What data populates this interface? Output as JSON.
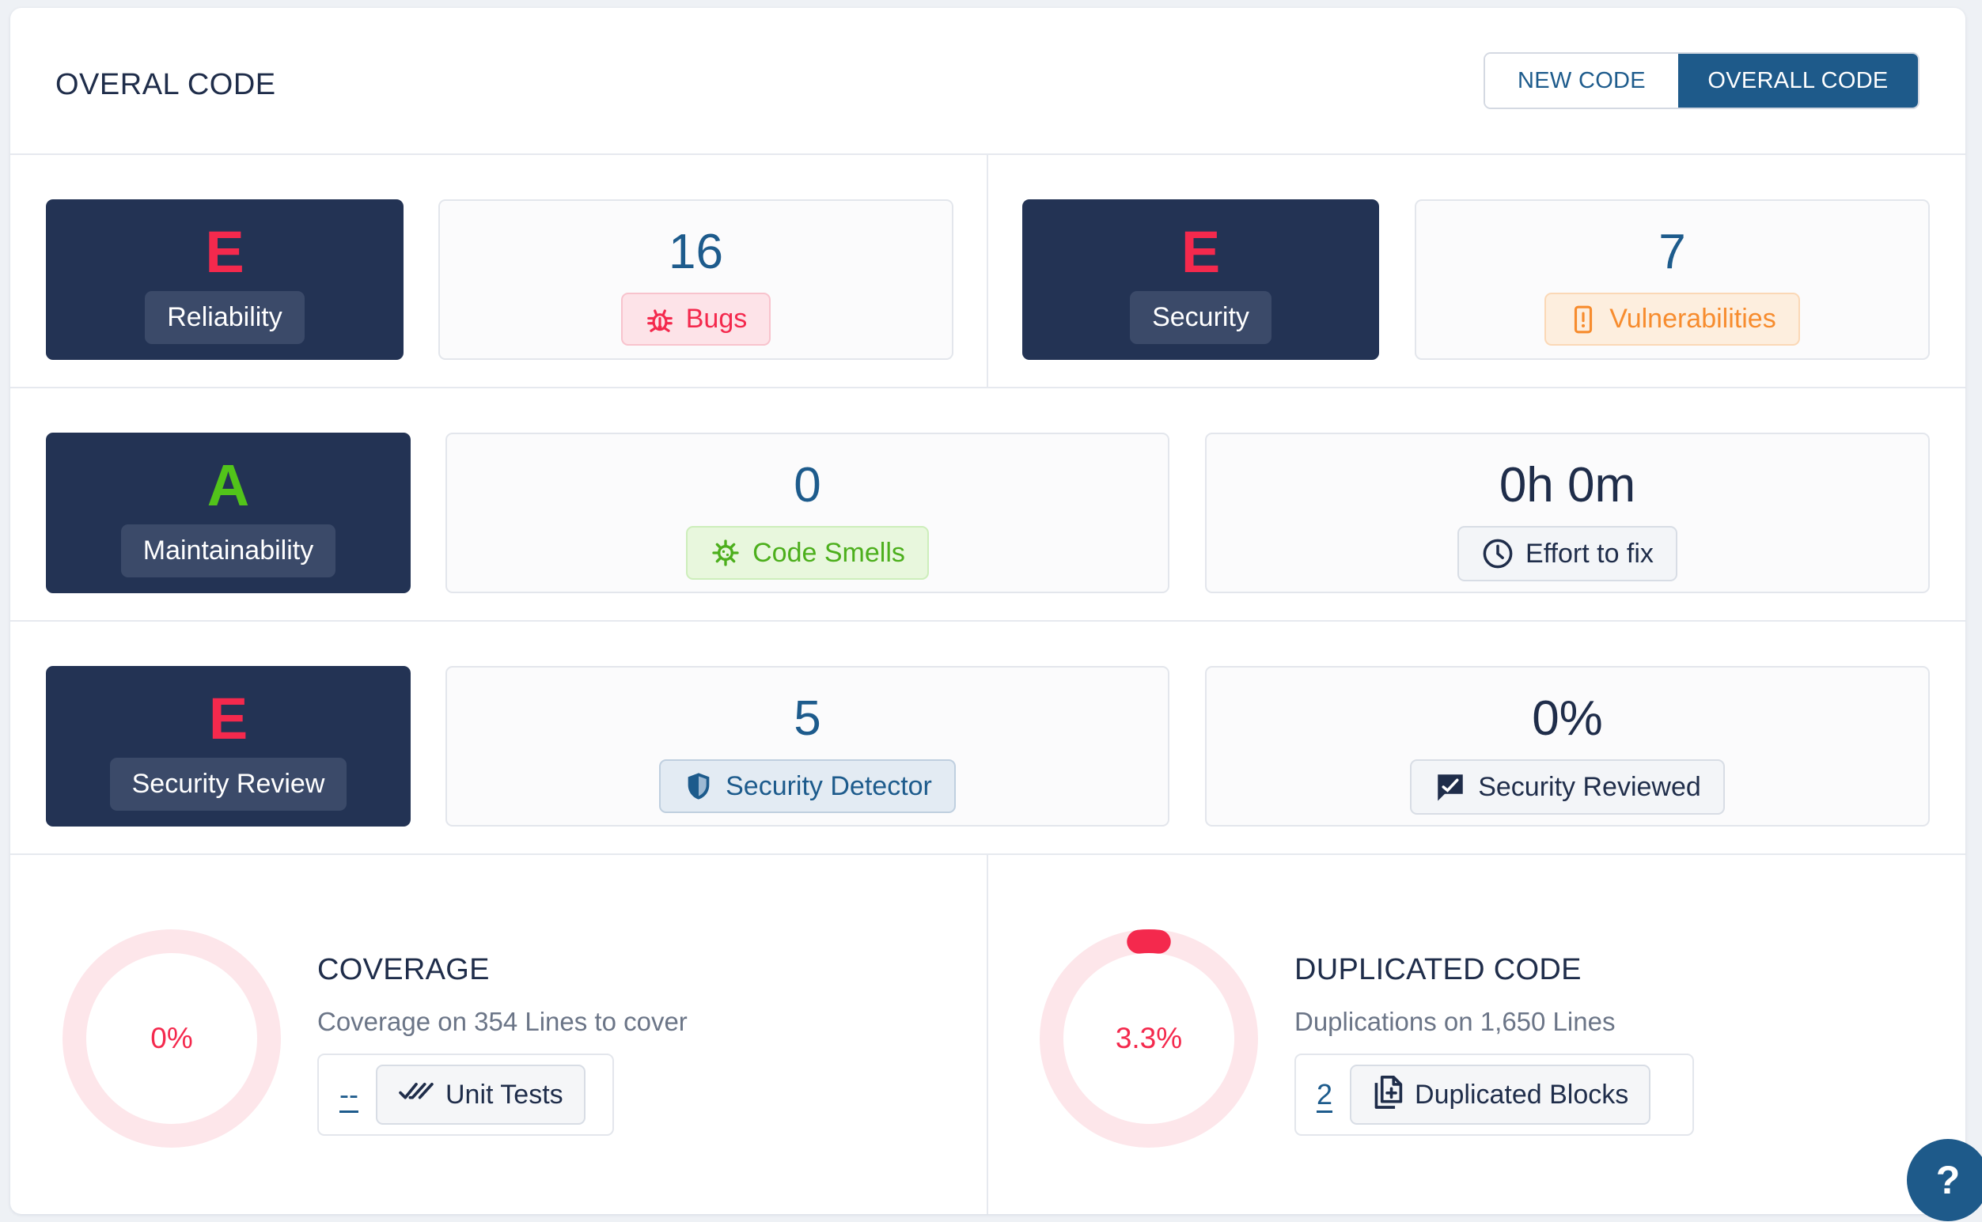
{
  "header": {
    "title": "OVERAL CODE",
    "toggle": {
      "new_label": "NEW CODE",
      "overall_label": "OVERALL CODE",
      "selected": "OVERALL CODE"
    }
  },
  "reliability": {
    "grade": "E",
    "label": "Reliability",
    "count": "16",
    "tag": "Bugs",
    "icon": "bug-icon"
  },
  "security": {
    "grade": "E",
    "label": "Security",
    "count": "7",
    "tag": "Vulnerabilities",
    "icon": "phone-alert-icon"
  },
  "maintainability": {
    "grade": "A",
    "label": "Maintainability",
    "count": "0",
    "tag": "Code Smells",
    "icon": "virus-icon",
    "effort_value": "0h 0m",
    "effort_tag": "Effort to fix",
    "effort_icon": "clock-icon"
  },
  "security_review": {
    "grade": "E",
    "label": "Security Review",
    "count": "5",
    "tag": "Security Detector",
    "icon": "shield-icon",
    "reviewed_value": "0%",
    "reviewed_tag": "Security Reviewed",
    "reviewed_icon": "pen-check-icon"
  },
  "coverage": {
    "title": "COVERAGE",
    "subtitle": "Coverage on 354 Lines to cover",
    "percent_label": "0%",
    "percent": 0,
    "link": "--",
    "button": "Unit Tests",
    "button_icon": "double-check-icon"
  },
  "duplication": {
    "title": "DUPLICATED CODE",
    "subtitle": "Duplications on 1,650 Lines",
    "percent_label": "3.3%",
    "percent": 3.3,
    "link": "2",
    "button": "Duplicated Blocks",
    "button_icon": "copy-doc-icon"
  },
  "help": {
    "label": "?"
  },
  "colors": {
    "grade_e": "#f4294d",
    "grade_a": "#52c41a",
    "navy": "#233354",
    "accent": "#1e5a8a"
  }
}
